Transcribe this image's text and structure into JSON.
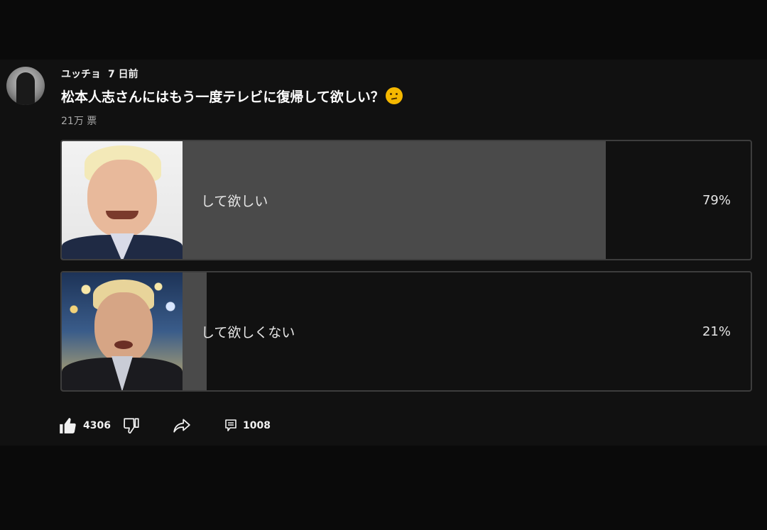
{
  "post": {
    "author": "ユッチョ",
    "time": "7 日前",
    "question": "松本人志さんにはもう一度テレビに復帰して欲しい？",
    "question_icon": "thinking-face-icon",
    "votes": "21万 票"
  },
  "poll": {
    "options": [
      {
        "label": "して欲しい",
        "percent_text": "79%",
        "share": 0.79
      },
      {
        "label": "して欲しくない",
        "percent_text": "21%",
        "share": 0.21
      }
    ]
  },
  "actions": {
    "likes": "4306",
    "comments": "1008"
  },
  "colors": {
    "background": "#0f0f0f",
    "bar_fill": "#4a4a4a",
    "border": "#3d3d3d"
  }
}
